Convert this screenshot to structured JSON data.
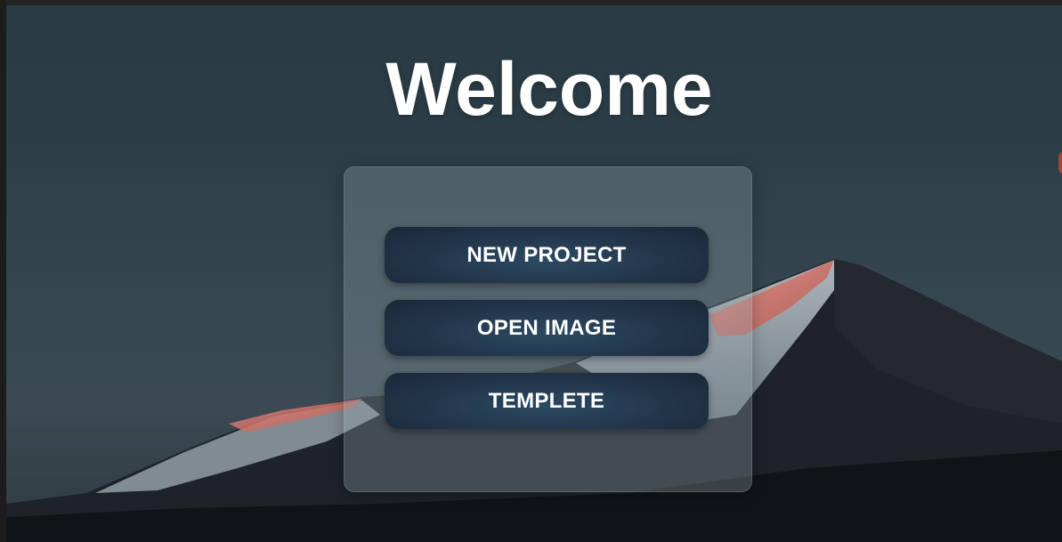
{
  "title": "Welcome",
  "menu": {
    "new_project": "NEW PROJECT",
    "open_image": "OPEN IMAGE",
    "templete": "TEMPLETE"
  },
  "colors": {
    "accent_button": "#22354a",
    "title_text": "#ffffff",
    "mountain_glow": "#d87a70"
  }
}
